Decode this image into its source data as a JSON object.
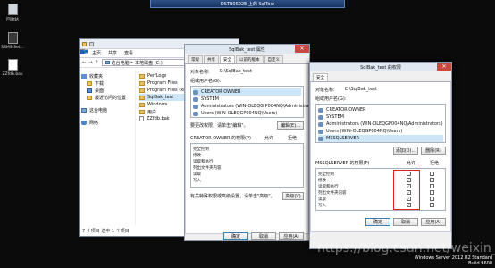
{
  "remote_bar": {
    "title": "DSTB0S02E 上的 SqlTest"
  },
  "desktop": {
    "icons": [
      {
        "label": "回收站"
      },
      {
        "label": "SSMS-Set..."
      },
      {
        "label": "ZZfdb.bak"
      }
    ],
    "watermark": {
      "line1": "Windows Server 2012 R2 Standard",
      "line2": "Build 9600",
      "blog": "https://blog.csdn.net/weixin_42665496"
    }
  },
  "explorer": {
    "ribbon_tabs": [
      "文件",
      "主页",
      "共享",
      "查看"
    ],
    "address": [
      "这台电脑",
      "本地磁盘 (C:)"
    ],
    "nav": [
      {
        "label": "收藏夹",
        "kind": "fav"
      },
      {
        "label": "下载",
        "kind": "fold"
      },
      {
        "label": "桌面",
        "kind": "fold"
      },
      {
        "label": "最近访问的位置",
        "kind": "fold"
      },
      {
        "label": "这台电脑",
        "kind": "pc"
      },
      {
        "label": "网络",
        "kind": "net"
      }
    ],
    "items": [
      {
        "label": "PerfLogs",
        "kind": "fold"
      },
      {
        "label": "Program Files",
        "kind": "fold"
      },
      {
        "label": "Program Files (x86)",
        "kind": "fold"
      },
      {
        "label": "SqlBak_test",
        "kind": "fold",
        "selected": true
      },
      {
        "label": "Windows",
        "kind": "fold"
      },
      {
        "label": "用户",
        "kind": "fold"
      },
      {
        "label": "ZZfdb.bak",
        "kind": "file"
      }
    ],
    "status": "7 个项目    选中 1 个项目"
  },
  "props": {
    "title": "SqlBak_test 属性",
    "tabs": [
      "常规",
      "共享",
      "安全",
      "以前的版本",
      "自定义"
    ],
    "object_label": "对象名称:",
    "object_value": "C:\\SqlBak_test",
    "group_label": "组或用户名(G):",
    "users": [
      "CREATOR OWNER",
      "SYSTEM",
      "Administrators (WIN-OLEQG P004NQ\\Administrators)",
      "Users (WIN-OLEQGP004NQ\\Users)"
    ],
    "change_hint": "要更改权限，请单击\"编辑\"。",
    "edit_btn": "编辑(E)...",
    "perm_label": "CREATOR OWNER 的权限(P)",
    "allow": "允许",
    "deny": "拒绝",
    "perms": [
      "完全控制",
      "修改",
      "读取和执行",
      "列出文件夹内容",
      "读取",
      "写入"
    ],
    "adv_hint": "有关特殊权限或高级设置，请单击\"高级\"。",
    "adv_btn": "高级(V)",
    "ok": "确定",
    "cancel": "取消",
    "apply": "应用(A)"
  },
  "perm": {
    "title": "SqlBak_test 的权限",
    "tab": "安全",
    "object_label": "对象名称:",
    "object_value": "C:\\SqlBak_test",
    "group_label": "组或用户名(G):",
    "users": [
      "CREATOR OWNER",
      "SYSTEM",
      "Administrators (WIN-OLEQGP004NQ\\Administrators)",
      "Users (WIN-OLEQGP004NQ\\Users)",
      "MSSQLSERVER"
    ],
    "add_btn": "添加(D)...",
    "remove_btn": "删除(R)",
    "perm_label": "MSSQLSERVER 的权限(P)",
    "allow": "允许",
    "deny": "拒绝",
    "perms": [
      {
        "name": "完全控制",
        "allow": false
      },
      {
        "name": "修改",
        "allow": true
      },
      {
        "name": "读取和执行",
        "allow": true
      },
      {
        "name": "列出文件夹内容",
        "allow": true
      },
      {
        "name": "读取",
        "allow": true
      },
      {
        "name": "写入",
        "allow": true
      }
    ],
    "ok": "确定",
    "cancel": "取消",
    "apply": "应用(A)",
    "highlight_color": "#e0201b"
  }
}
